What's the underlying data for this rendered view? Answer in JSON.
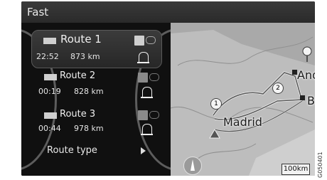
{
  "header": {
    "title": "Fast"
  },
  "routes": [
    {
      "name": "Route 1",
      "time": "22:52",
      "distance": "873 km"
    },
    {
      "name": "Route 2",
      "time": "00:19",
      "distance": "828 km"
    },
    {
      "name": "Route 3",
      "time": "00:44",
      "distance": "978 km"
    }
  ],
  "route_type": {
    "label": "Route type"
  },
  "map": {
    "labels": {
      "andorra": "Andor",
      "barcelona": "Barc",
      "madrid": "Madrid"
    },
    "markers": {
      "m1": "1",
      "m2": "2"
    },
    "scale": "100km"
  },
  "figure_code": "G050401"
}
